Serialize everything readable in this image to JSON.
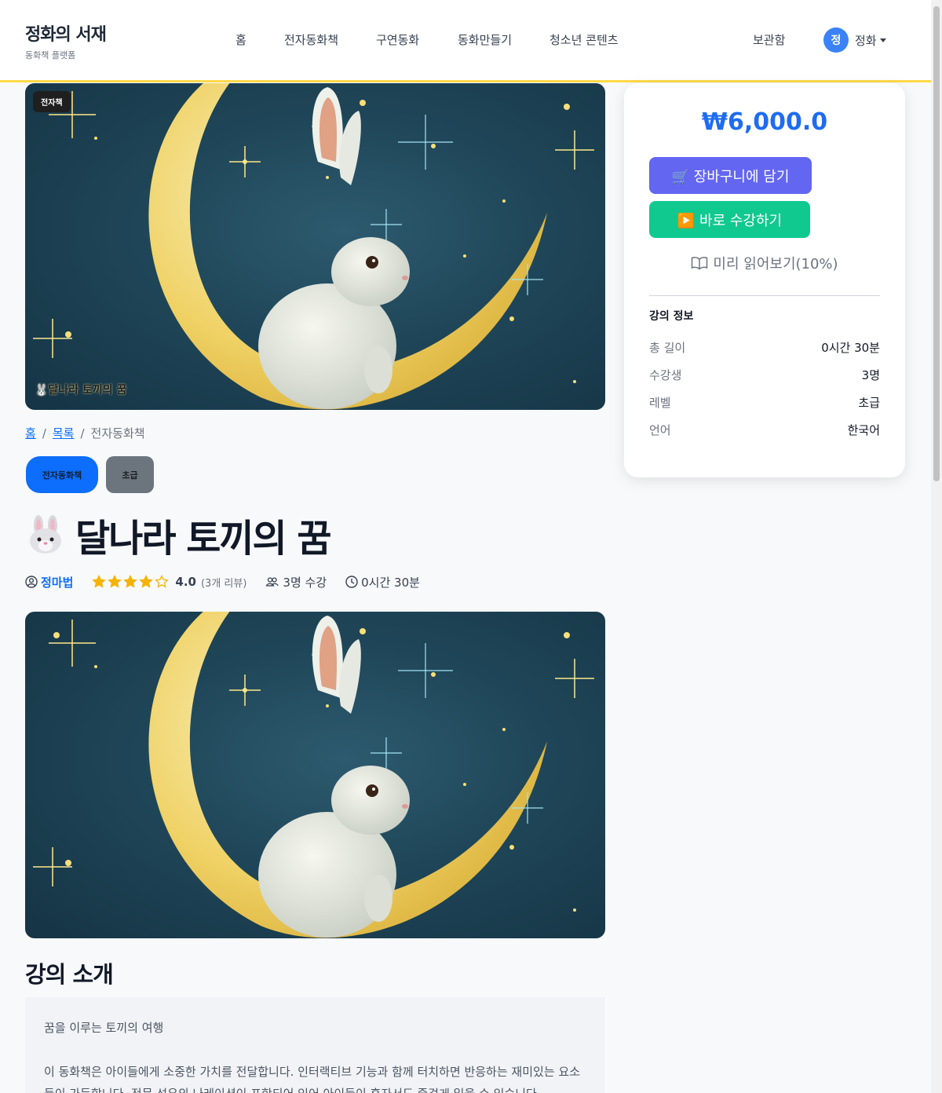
{
  "header": {
    "brand_title": "정화의 서재",
    "brand_sub": "동화책 플랫폼",
    "nav": [
      "홈",
      "전자동화책",
      "구연동화",
      "동화만들기",
      "청소년 콘텐츠"
    ],
    "storage": "보관함",
    "user_initial": "정",
    "user_name": "정화"
  },
  "hero": {
    "tag": "전자책",
    "caption": "🐰달나라 토끼의 꿈"
  },
  "breadcrumb": {
    "home": "홈",
    "list": "목록",
    "current": "전자동화책",
    "separator": "/"
  },
  "badges": {
    "category": "전자동화책",
    "level": "초급"
  },
  "course": {
    "title": "달나라 토끼의 꿈",
    "author": "정마법",
    "rating": "4.0",
    "rating_value": 4,
    "rating_max": 5,
    "reviews": "(3개 리뷰)",
    "students": "3명 수강",
    "duration": "0시간 30분"
  },
  "intro": {
    "heading": "강의 소개",
    "line1": "꿈을 이루는 토끼의 여행",
    "line2": "이 동화책은 아이들에게 소중한 가치를 전달합니다. 인터랙티브 기능과 함께 터치하면 반응하는 재미있는 요소들이 가득합니다. 전문 성우의 나레이션이 포함되어 있어 아이들이 혼자서도 즐겁게 읽을 수 있습니다."
  },
  "sidebar": {
    "price": "₩6,000.0",
    "cart_button": "🛒 장바구니에 담기",
    "enroll_button": "▶️ 바로 수강하기",
    "preview_button": "미리 읽어보기(10%)",
    "info_title": "강의 정보",
    "info": [
      {
        "label": "총 길이",
        "value": "0시간 30분"
      },
      {
        "label": "수강생",
        "value": "3명"
      },
      {
        "label": "레벨",
        "value": "초급"
      },
      {
        "label": "언어",
        "value": "한국어"
      }
    ]
  },
  "colors": {
    "accent": "#0d6efd",
    "price": "#1d6cf2",
    "cart": "#6366f1",
    "enroll": "#10c98f",
    "header_border": "#ffd94a",
    "star": "#f5b301"
  },
  "icons": [
    "cart-icon",
    "play-icon",
    "book-icon",
    "user-circle-icon",
    "star-icon",
    "people-icon",
    "clock-icon",
    "chevron-down-icon"
  ]
}
